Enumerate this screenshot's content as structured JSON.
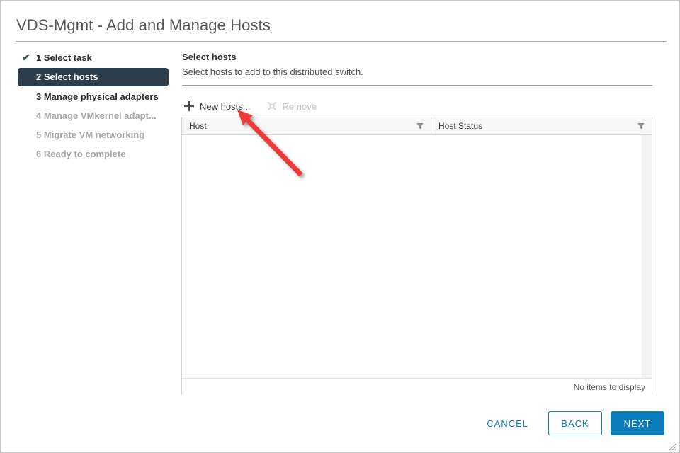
{
  "window": {
    "title": "VDS-Mgmt - Add and Manage Hosts",
    "resize_grip_icon": "resize-grip-icon"
  },
  "steps": [
    {
      "num": "1",
      "label": "1 Select task",
      "state": "done",
      "tick": "✔"
    },
    {
      "num": "2",
      "label": "2 Select hosts",
      "state": "active"
    },
    {
      "num": "3",
      "label": "3 Manage physical adapters",
      "state": "enabled"
    },
    {
      "num": "4",
      "label": "4 Manage VMkernel adapt...",
      "state": "disabled"
    },
    {
      "num": "5",
      "label": "5 Migrate VM networking",
      "state": "disabled"
    },
    {
      "num": "6",
      "label": "6 Ready to complete",
      "state": "disabled"
    }
  ],
  "pane": {
    "title": "Select hosts",
    "subtitle": "Select hosts to add to this distributed switch."
  },
  "actions": {
    "new_hosts": {
      "label": "New hosts...",
      "icon": "plus-icon",
      "enabled": true
    },
    "remove": {
      "label": "Remove",
      "icon": "remove-host-icon",
      "enabled": false
    }
  },
  "table": {
    "columns": [
      {
        "label": "Host",
        "filter_icon": "funnel-icon"
      },
      {
        "label": "Host Status",
        "filter_icon": "funnel-icon"
      }
    ],
    "rows": [],
    "empty_text": "No items to display"
  },
  "footer": {
    "cancel_label": "CANCEL",
    "back_label": "BACK",
    "next_label": "NEXT"
  },
  "colors": {
    "accent": "#0c7cba",
    "active_step_bg": "#2c3e4c",
    "annotation_arrow": "#ef3b39",
    "title_text": "#565656"
  }
}
